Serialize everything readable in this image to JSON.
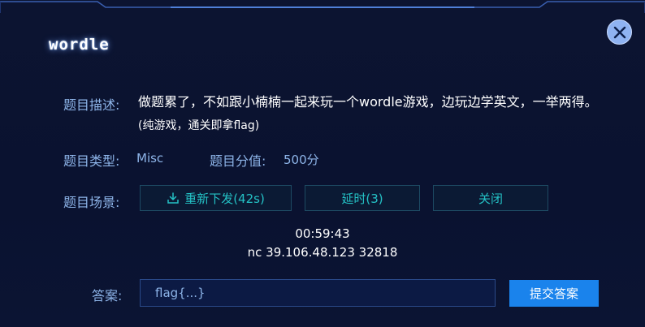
{
  "dialog": {
    "title": "wordle",
    "close_icon": "close-icon"
  },
  "description": {
    "label": "题目描述:",
    "text": "做题累了，不如跟小楠楠一起来玩一个wordle游戏，边玩边学英文，一举两得。",
    "note": "(纯游戏，通关即拿flag)"
  },
  "category": {
    "label": "题目类型:",
    "value": "Misc"
  },
  "score": {
    "label": "题目分值:",
    "value": "500分"
  },
  "scene": {
    "label": "题目场景:",
    "redeploy_label": "重新下发(42s)",
    "redeploy_icon": "download-icon",
    "extend_label": "延时(3)",
    "close_label": "关闭",
    "timer": "00:59:43",
    "address": "nc 39.106.48.123 32818"
  },
  "answer": {
    "label": "答案:",
    "value": "flag{...}",
    "submit_label": "提交答案"
  },
  "colors": {
    "background": "#0a1230",
    "label": "#8db4e8",
    "teal_button_text": "#24c1c5",
    "submit_button": "#1a83ec"
  }
}
